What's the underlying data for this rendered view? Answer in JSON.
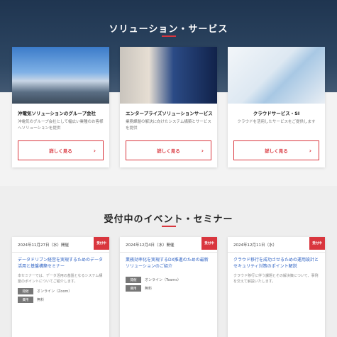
{
  "solutions": {
    "title": "ソリューション・サービス",
    "cards": [
      {
        "name": "沖電気ソリューションのグループ会社",
        "desc": "沖電気のグループ会社として幅広い業種のお客様へソリューションを提供",
        "button": "詳しく見る",
        "image": "city-skyline"
      },
      {
        "name": "エンタープライズソリューションサービス",
        "desc": "業務課題の解決に向けたシステム構築とサービスを提供",
        "button": "詳しく見る",
        "image": "business-technology"
      },
      {
        "name": "クラウドサービス・SI",
        "desc": "クラウドを活用したサービスをご提供します",
        "button": "詳しく見る",
        "image": "network-cubes"
      }
    ]
  },
  "events": {
    "title": "受付中のイベント・セミナー",
    "items": [
      {
        "date": "2024年11月27日（水）開催",
        "badge": "受付中",
        "title": "データドリブン経営を実現するためのデータ活用と基盤構築セミナー",
        "body": "本セミナーでは、データ活用の基盤となるシステム構築のポイントについてご紹介します。",
        "tags": [
          {
            "label": "開催",
            "text": "オンライン（Zoom）"
          },
          {
            "label": "費用",
            "text": "無料"
          }
        ]
      },
      {
        "date": "2024年12月4日（水）開催",
        "badge": "受付中",
        "title": "業務効率化を実現するDX推進のための最新ソリューションのご紹介",
        "body": "",
        "tags": [
          {
            "label": "開催",
            "text": "オンライン（Teams）"
          },
          {
            "label": "費用",
            "text": "無料"
          }
        ]
      },
      {
        "date": "2024年12月11日（水）",
        "badge": "受付中",
        "title": "クラウド移行を成功させるための運用設計とセキュリティ対策のポイント解説",
        "body": "クラウド移行に伴う課題とその解決策について、事例を交えて解説いたします。",
        "tags": []
      }
    ]
  },
  "colors": {
    "accent": "#d9363e",
    "link": "#2a5fc2",
    "hero_dark": "#1f3550"
  }
}
